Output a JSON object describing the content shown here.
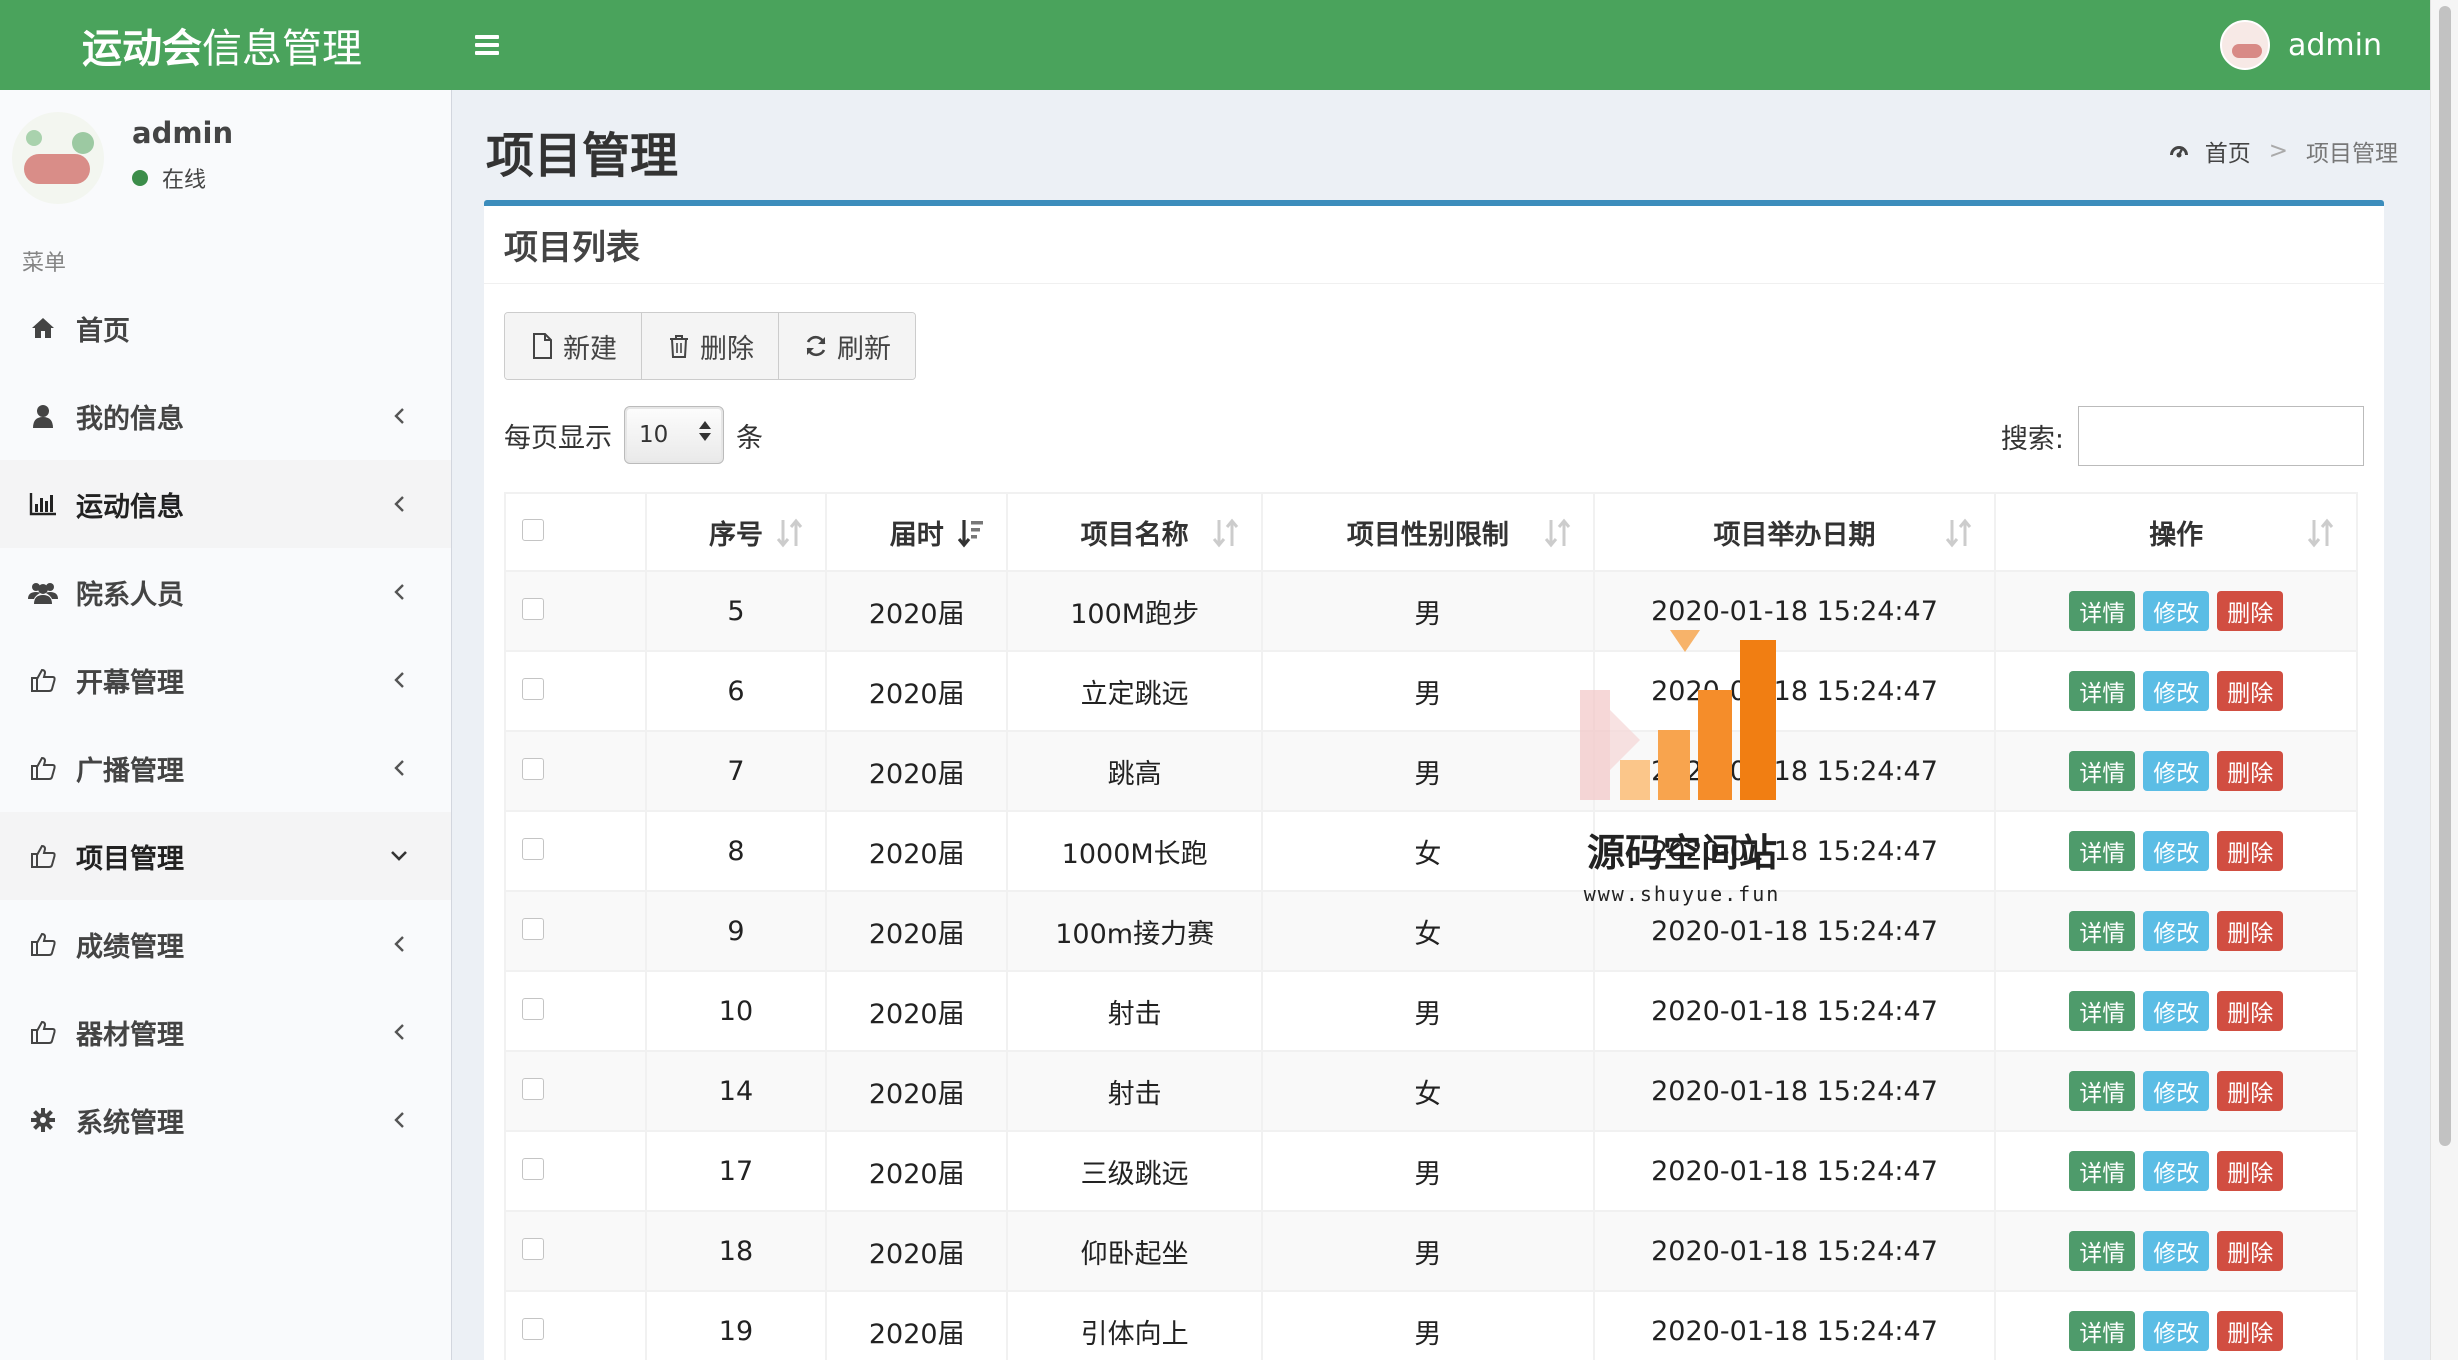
{
  "app": {
    "title_bold": "运动会",
    "title_light": "信息管理",
    "user": "admin"
  },
  "sidebar": {
    "user_name": "admin",
    "status": "在线",
    "menu_header": "菜单",
    "items": [
      {
        "label": "首页",
        "icon": "home-icon",
        "chevron": "none"
      },
      {
        "label": "我的信息",
        "icon": "user-icon",
        "chevron": "left"
      },
      {
        "label": "运动信息",
        "icon": "bar-chart-icon",
        "chevron": "left"
      },
      {
        "label": "院系人员",
        "icon": "users-icon",
        "chevron": "left"
      },
      {
        "label": "开幕管理",
        "icon": "thumbs-up-icon",
        "chevron": "left"
      },
      {
        "label": "广播管理",
        "icon": "thumbs-up-icon",
        "chevron": "left"
      },
      {
        "label": "项目管理",
        "icon": "thumbs-up-icon",
        "chevron": "down"
      },
      {
        "label": "成绩管理",
        "icon": "thumbs-up-icon",
        "chevron": "left"
      },
      {
        "label": "器材管理",
        "icon": "thumbs-up-icon",
        "chevron": "left"
      },
      {
        "label": "系统管理",
        "icon": "gear-icon",
        "chevron": "left"
      }
    ]
  },
  "page": {
    "title": "项目管理",
    "breadcrumb_home": "首页",
    "breadcrumb_sep": ">",
    "breadcrumb_current": "项目管理",
    "box_title": "项目列表"
  },
  "toolbar": {
    "new_label": "新建",
    "delete_label": "删除",
    "refresh_label": "刷新"
  },
  "length": {
    "prefix": "每页显示",
    "value": "10",
    "suffix": "条"
  },
  "search": {
    "label": "搜索:",
    "value": ""
  },
  "table": {
    "columns": [
      "序号",
      "届时",
      "项目名称",
      "项目性别限制",
      "项目举办日期",
      "操作"
    ],
    "action_labels": {
      "detail": "详情",
      "edit": "修改",
      "delete": "删除"
    },
    "rows": [
      {
        "id": "5",
        "session": "2020届",
        "name": "100M跑步",
        "gender": "男",
        "date": "2020-01-18 15:24:47"
      },
      {
        "id": "6",
        "session": "2020届",
        "name": "立定跳远",
        "gender": "男",
        "date": "2020-01-18 15:24:47"
      },
      {
        "id": "7",
        "session": "2020届",
        "name": "跳高",
        "gender": "男",
        "date": "2020-01-18 15:24:47"
      },
      {
        "id": "8",
        "session": "2020届",
        "name": "1000M长跑",
        "gender": "女",
        "date": "2020-01-18 15:24:47"
      },
      {
        "id": "9",
        "session": "2020届",
        "name": "100m接力赛",
        "gender": "女",
        "date": "2020-01-18 15:24:47"
      },
      {
        "id": "10",
        "session": "2020届",
        "name": "射击",
        "gender": "男",
        "date": "2020-01-18 15:24:47"
      },
      {
        "id": "14",
        "session": "2020届",
        "name": "射击",
        "gender": "女",
        "date": "2020-01-18 15:24:47"
      },
      {
        "id": "17",
        "session": "2020届",
        "name": "三级跳远",
        "gender": "男",
        "date": "2020-01-18 15:24:47"
      },
      {
        "id": "18",
        "session": "2020届",
        "name": "仰卧起坐",
        "gender": "男",
        "date": "2020-01-18 15:24:47"
      },
      {
        "id": "19",
        "session": "2020届",
        "name": "引体向上",
        "gender": "男",
        "date": "2020-01-18 15:24:47"
      }
    ]
  },
  "watermark": {
    "text": "源码空间站",
    "url": "www.shuyue.fun"
  },
  "colors": {
    "header": "#4aa35c",
    "box_border": "#3c8dbc",
    "detail": "#4e9b6b",
    "edit": "#5bbde5",
    "delete": "#d14e41"
  }
}
